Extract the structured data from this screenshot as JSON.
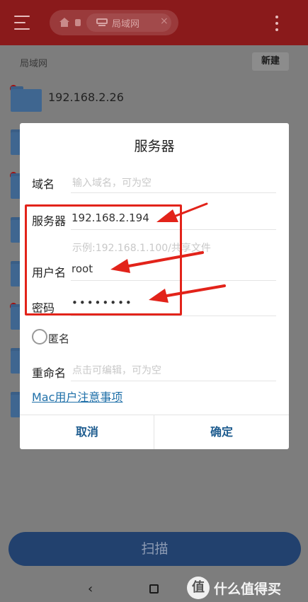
{
  "topbar": {
    "breadcrumb_current": "局域网",
    "close_glyph": "×"
  },
  "list": {
    "section_label": "局域网",
    "new_label": "新建",
    "first_item_name": "192.168.2.26"
  },
  "dialog": {
    "title": "服务器",
    "domain": {
      "label": "域名",
      "placeholder": "输入域名，可为空"
    },
    "server": {
      "label": "服务器",
      "value": "192.168.2.194",
      "hint": "示例:192.168.1.100/共享文件"
    },
    "username": {
      "label": "用户名",
      "value": "root"
    },
    "password": {
      "label": "密码",
      "masked_value": "••••••••"
    },
    "anonymous_label": "匿名",
    "rename": {
      "label": "重命名",
      "placeholder": "点击可编辑，可为空"
    },
    "mac_link": "Mac用户注意事项",
    "cancel_label": "取消",
    "confirm_label": "确定"
  },
  "scan_label": "扫描",
  "navbar": {
    "back_glyph": "‹",
    "watermark_logo": "值",
    "watermark_text": "什么值得买"
  },
  "colors": {
    "accent": "#1e5c8f",
    "annotation_red": "#e2231a",
    "toolbar_red": "#8a1a1b"
  }
}
